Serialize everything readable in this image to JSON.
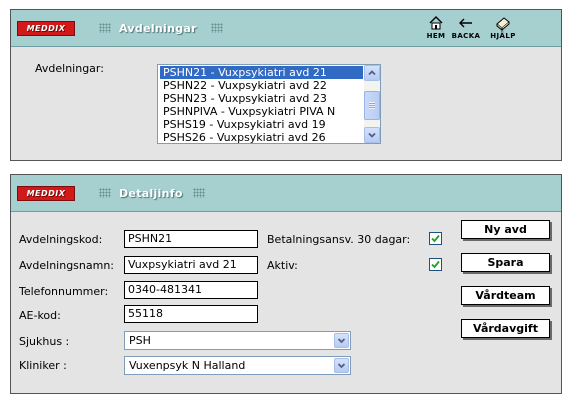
{
  "panel_list": {
    "logo": "MEDDIX",
    "title": "Avdelningar",
    "nav": [
      {
        "label": "HEM",
        "icon": "home-icon"
      },
      {
        "label": "BACKA",
        "icon": "back-arrow-icon"
      },
      {
        "label": "HJÄLP",
        "icon": "help-book-icon"
      }
    ],
    "field_label": "Avdelningar:",
    "items": [
      "PSHN21 - Vuxpsykiatri avd 21",
      "PSHN22 - Vuxpsykiatri avd 22",
      "PSHN23 - Vuxpsykiatri avd 23",
      "PSHNPIVA - Vuxpsykiatri PIVA N",
      "PSHS19 - Vuxpsykiatri avd 19",
      "PSHS26 - Vuxpsykiatri avd 26"
    ],
    "selected_index": 0
  },
  "panel_detail": {
    "logo": "MEDDIX",
    "title": "Detaljinfo",
    "fields": {
      "kod": {
        "label": "Avdelningskod:",
        "value": "PSHN21"
      },
      "namn": {
        "label": "Avdelningsnamn:",
        "value": "Vuxpsykiatri avd 21"
      },
      "telefon": {
        "label": "Telefonnummer:",
        "value": "0340-481341"
      },
      "aekod": {
        "label": "AE-kod:",
        "value": "55118"
      },
      "sjukhus": {
        "label": "Sjukhus :",
        "value": "PSH"
      },
      "kliniker": {
        "label": "Kliniker :",
        "value": "Vuxenpsyk N Halland"
      }
    },
    "checks": {
      "betalning": {
        "label": "Betalningsansv. 30 dagar:",
        "checked": true
      },
      "aktiv": {
        "label": "Aktiv:",
        "checked": true
      }
    },
    "buttons": {
      "ny": "Ny avd",
      "spara": "Spara",
      "vardteam": "Vårdteam",
      "vardavgift": "Vårdavgift"
    }
  },
  "colors": {
    "header": "#a6cfd0",
    "panel_bg": "#e4e4e4",
    "selection": "#316ac5",
    "logo_red": "#d21818"
  }
}
